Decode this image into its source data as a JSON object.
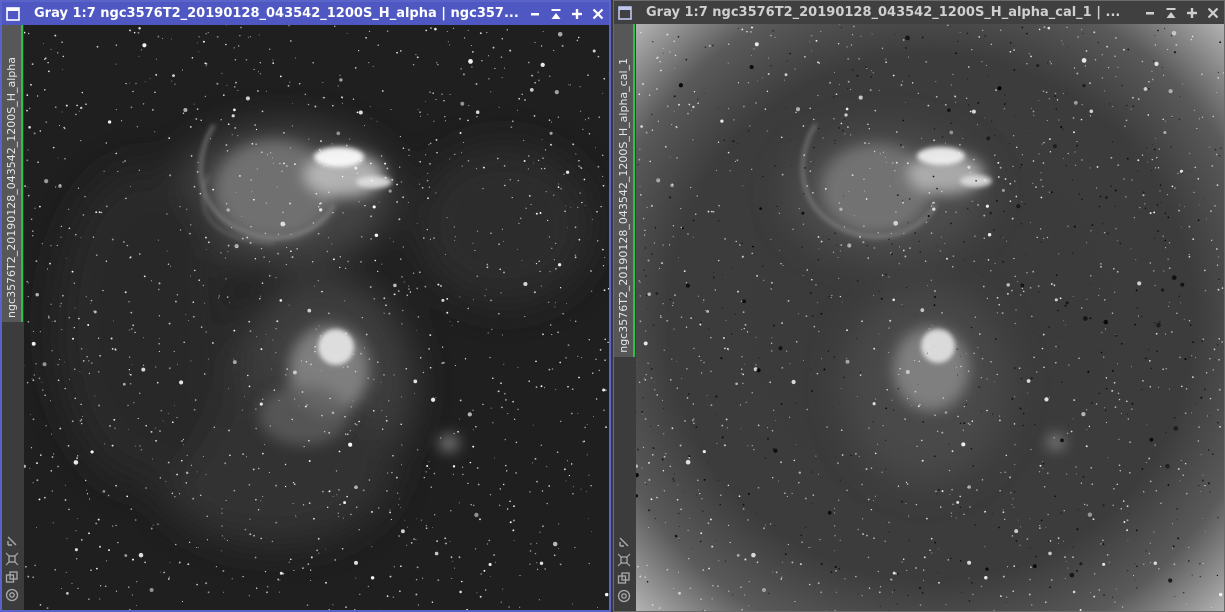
{
  "windows": [
    {
      "id": "left",
      "title": "Gray 1:7 ngc3576T2_20190128_043542_1200S_H_alpha | ngc357...",
      "tab_label": "ngc3576T2_20190128_043542_1200S_H_alpha",
      "active": true,
      "controls": [
        "minimize-icon",
        "shade-icon",
        "maximize-icon",
        "close-icon"
      ],
      "sidebar_icons": [
        "fit-view-icon",
        "zoom-icon",
        "clone-icon",
        "target-icon"
      ]
    },
    {
      "id": "right",
      "title": "Gray 1:7 ngc3576T2_20190128_043542_1200S_H_alpha_cal_1 | ...",
      "tab_label": "ngc3576T2_20190128_043542_1200S_H_alpha_cal_1",
      "active": false,
      "controls": [
        "minimize-icon",
        "shade-icon",
        "maximize-icon",
        "close-icon"
      ],
      "sidebar_icons": [
        "fit-view-icon",
        "zoom-icon",
        "clone-icon",
        "target-icon"
      ]
    }
  ],
  "colors": {
    "active_title_bg": "#4e57c2",
    "inactive_title_bg": "#404040",
    "tab_accent": "#2fbf4a",
    "window_border_active": "#5a63c8"
  }
}
